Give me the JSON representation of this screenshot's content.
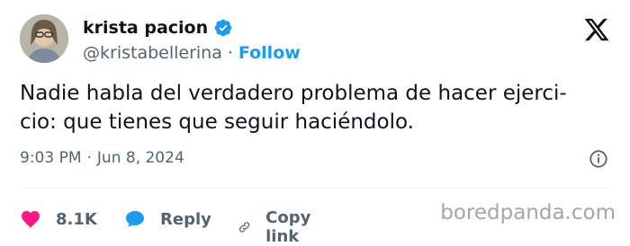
{
  "author": {
    "display_name": "krista pacion",
    "handle": "@kristabellerina",
    "separator": "·",
    "follow_label": "Follow"
  },
  "tweet": {
    "text": "Nadie habla del verdadero problema de hacer ejerci-\ncio: que tienes que seguir haciéndolo."
  },
  "meta": {
    "time": "9:03 PM",
    "separator": "·",
    "date": "Jun 8, 2024"
  },
  "actions": {
    "likes": "8.1K",
    "reply_label": "Reply",
    "copy_link_label": "Copy link"
  },
  "colors": {
    "accent": "#1d9bf0",
    "like": "#f91880",
    "muted": "#536471"
  },
  "icons": [
    "verified-icon",
    "x-logo-icon",
    "info-icon",
    "heart-icon",
    "reply-icon",
    "link-icon"
  ],
  "watermark": "boredpanda.com"
}
